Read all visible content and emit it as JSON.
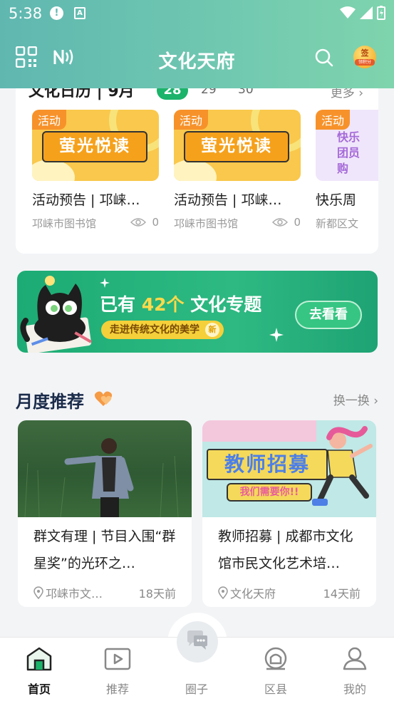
{
  "status_bar": {
    "time": "5:38",
    "notif_icon": "!",
    "app_icon": "A"
  },
  "header": {
    "title": "文化天府",
    "sign_badge_top": "签",
    "sign_badge_bottom": "领积分"
  },
  "calendar": {
    "title": "文化日历 | 9月",
    "dates": [
      "28",
      "29",
      "30"
    ],
    "selected_date": "28",
    "more_label": "更多 ›",
    "events": [
      {
        "tag": "活动",
        "banner": "萤光悦读",
        "title": "活动预告 | 邛崃…",
        "venue": "邛崃市图书馆",
        "views": "0"
      },
      {
        "tag": "活动",
        "banner": "萤光悦读",
        "title": "活动预告 | 邛崃…",
        "venue": "邛崃市图书馆",
        "views": "0"
      },
      {
        "tag": "活动",
        "banner": "快乐团员购",
        "title": "快乐周",
        "venue": "新都区文",
        "views": ""
      }
    ]
  },
  "promo": {
    "lead_prefix": "已有",
    "count": "42个",
    "lead_suffix": "文化专题",
    "subtitle": "走进传统文化的美学",
    "new_badge": "新",
    "button_label": "去看看"
  },
  "monthly": {
    "title": "月度推荐",
    "swap_label": "换一换 ›",
    "items": [
      {
        "title": "群文有理 | 节目入围“群星奖”的光环之…",
        "location": "邛崃市文…",
        "time": "18天前"
      },
      {
        "title": "教师招募 | 成都市文化馆市民文化艺术培…",
        "location": "文化天府",
        "time": "14天前",
        "poster_title": "教师招募",
        "poster_sub": "我们需要你!!"
      }
    ]
  },
  "tabbar": {
    "items": [
      {
        "label": "首页",
        "active": true
      },
      {
        "label": "推荐",
        "active": false
      },
      {
        "label": "圈子",
        "active": false
      },
      {
        "label": "区县",
        "active": false
      },
      {
        "label": "我的",
        "active": false
      }
    ]
  },
  "colors": {
    "header": "#6cc3b0",
    "accent_green": "#1cb36a",
    "tag_orange": "#f7922a"
  }
}
